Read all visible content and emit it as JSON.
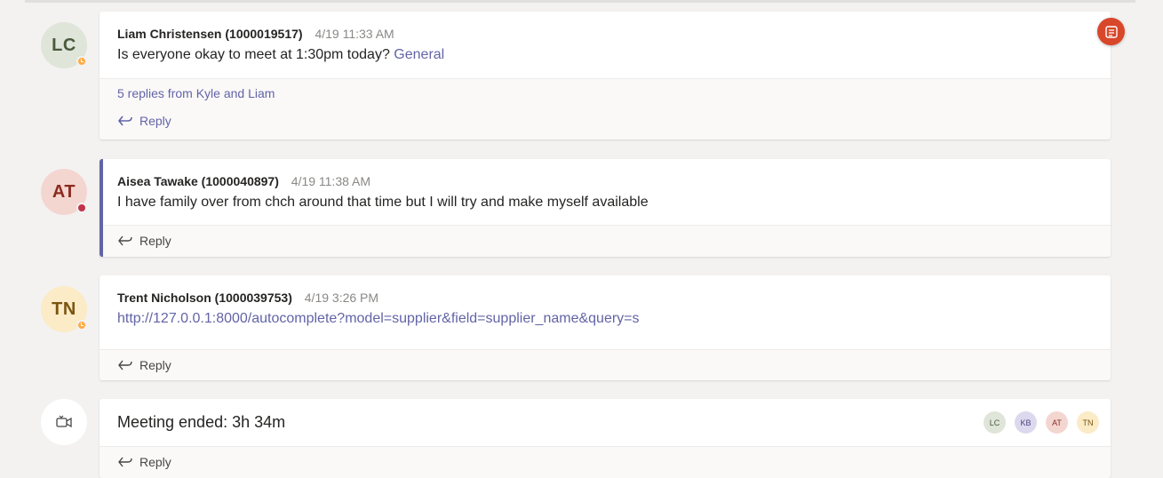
{
  "colors": {
    "accent": "#6264a7",
    "background": "#f3f2f1",
    "busy": "#c4314b",
    "away": "#ffaa44",
    "app_badge": "#d9472b"
  },
  "messages": [
    {
      "initials": "LC",
      "avatar_bg": "#dfe5d9",
      "avatar_fg": "#4b5a3e",
      "presence": "away",
      "author": "Liam Christensen (1000019517)",
      "time": "4/19 11:33 AM",
      "text": "Is everyone okay to meet at 1:30pm today?",
      "mention": "General",
      "replies_summary": "5 replies from Kyle and Liam",
      "reply_label": "Reply"
    },
    {
      "initials": "AT",
      "avatar_bg": "#f4d6d1",
      "avatar_fg": "#8a2b1e",
      "presence": "busy",
      "author": "Aisea Tawake (1000040897)",
      "time": "4/19 11:38 AM",
      "text": "I have family over from chch around that time but I will try and make myself available",
      "reply_label": "Reply"
    },
    {
      "initials": "TN",
      "avatar_bg": "#fbebc6",
      "avatar_fg": "#7a5410",
      "presence": "away",
      "author": "Trent Nicholson (1000039753)",
      "time": "4/19 3:26 PM",
      "link": "http://127.0.0.1:8000/autocomplete?model=supplier&field=supplier_name&query=s",
      "reply_label": "Reply"
    }
  ],
  "meeting": {
    "icon": "video-camera-icon",
    "title": "Meeting ended: 3h 34m",
    "participants": [
      {
        "initials": "LC",
        "bg": "#dfe5d9",
        "fg": "#4b5a3e"
      },
      {
        "initials": "KB",
        "bg": "#dcd9ee",
        "fg": "#4a4580"
      },
      {
        "initials": "AT",
        "bg": "#f4d6d1",
        "fg": "#8a2b1e"
      },
      {
        "initials": "TN",
        "bg": "#fbebc6",
        "fg": "#7a5410"
      }
    ],
    "reply_label": "Reply"
  },
  "floating_button": {
    "icon": "app-list-icon"
  }
}
